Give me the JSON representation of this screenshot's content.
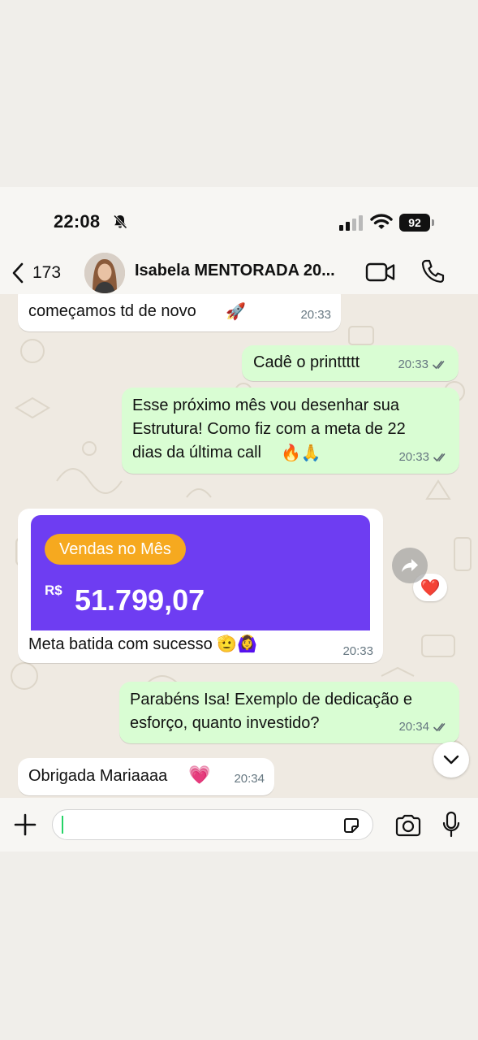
{
  "status_bar": {
    "time": "22:08",
    "battery": "92",
    "icons": [
      "bell-slash-icon",
      "signal-icon",
      "wifi-icon",
      "battery-icon"
    ]
  },
  "header": {
    "back_count": "173",
    "contact_name": "Isabela MENTORADA 20...",
    "icons": [
      "chevron-left-icon",
      "video-call-icon",
      "phone-icon"
    ]
  },
  "messages": [
    {
      "direction": "in",
      "text": "começamos td de novo",
      "emoji": "🚀",
      "time": "20:33"
    },
    {
      "direction": "out",
      "text": "Cadê o printtttt",
      "time": "20:33",
      "read": true
    },
    {
      "direction": "out",
      "lines": [
        "Esse próximo mês vou desenhar sua",
        "Estrutura! Como fiz com a meta de 22",
        "dias da última call"
      ],
      "emoji": "🔥🙏",
      "time": "20:33",
      "read": true,
      "reaction": "❤️"
    },
    {
      "direction": "in",
      "type": "image",
      "image": {
        "pill": "Vendas no Mês",
        "currency": "R$",
        "amount": "51.799,07"
      },
      "caption": "Meta batida com sucesso",
      "emoji": "🫡🙆‍♀️",
      "time": "20:33"
    },
    {
      "direction": "out",
      "lines": [
        "Parabéns Isa! Exemplo de dedicação e",
        "esforço, quanto investido?"
      ],
      "time": "20:34",
      "read": true
    },
    {
      "direction": "in",
      "text": "Obrigada Mariaaaa",
      "emoji": "💗",
      "time": "20:34"
    }
  ],
  "input_bar": {
    "placeholder": "",
    "icons": [
      "plus-icon",
      "sticker-icon",
      "camera-icon",
      "microphone-icon"
    ]
  },
  "colors": {
    "outgoing_bubble": "#d9fdd3",
    "incoming_bubble": "#ffffff",
    "chat_background": "#efeae2",
    "card_purple": "#6e3df2",
    "pill_orange": "#f6a91f",
    "ticks_read": "#5f6b72"
  }
}
